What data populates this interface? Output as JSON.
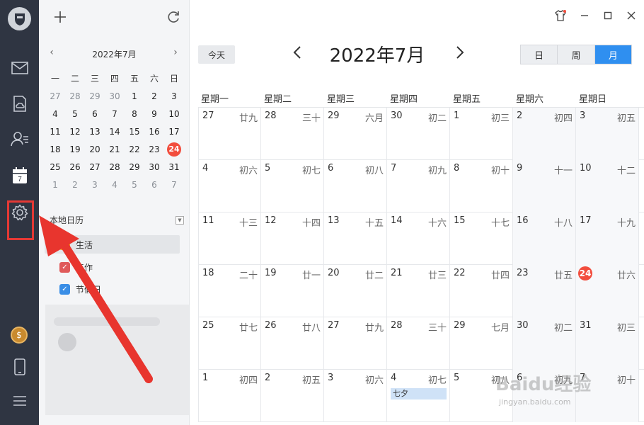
{
  "sidebar": {
    "mini_title": "2022年7月",
    "weekdays": [
      "一",
      "二",
      "三",
      "四",
      "五",
      "六",
      "日"
    ],
    "weeks": [
      [
        {
          "d": "27",
          "dim": true
        },
        {
          "d": "28",
          "dim": true
        },
        {
          "d": "29",
          "dim": true
        },
        {
          "d": "30",
          "dim": true
        },
        {
          "d": "1"
        },
        {
          "d": "2"
        },
        {
          "d": "3"
        }
      ],
      [
        {
          "d": "4"
        },
        {
          "d": "5"
        },
        {
          "d": "6"
        },
        {
          "d": "7"
        },
        {
          "d": "8"
        },
        {
          "d": "9"
        },
        {
          "d": "10"
        }
      ],
      [
        {
          "d": "11"
        },
        {
          "d": "12"
        },
        {
          "d": "13"
        },
        {
          "d": "14"
        },
        {
          "d": "15"
        },
        {
          "d": "16"
        },
        {
          "d": "17"
        }
      ],
      [
        {
          "d": "18"
        },
        {
          "d": "19"
        },
        {
          "d": "20"
        },
        {
          "d": "21"
        },
        {
          "d": "22"
        },
        {
          "d": "23"
        },
        {
          "d": "24",
          "today": true
        }
      ],
      [
        {
          "d": "25"
        },
        {
          "d": "26"
        },
        {
          "d": "27"
        },
        {
          "d": "28"
        },
        {
          "d": "29"
        },
        {
          "d": "30"
        },
        {
          "d": "31"
        }
      ],
      [
        {
          "d": "1",
          "dim": true
        },
        {
          "d": "2",
          "dim": true
        },
        {
          "d": "3",
          "dim": true
        },
        {
          "d": "4",
          "dim": true
        },
        {
          "d": "5",
          "dim": true
        },
        {
          "d": "6",
          "dim": true
        },
        {
          "d": "7",
          "dim": true
        }
      ]
    ],
    "section_label": "本地日历",
    "calendars": [
      {
        "label": "生活",
        "color": "#f5a623",
        "selected": true
      },
      {
        "label": "工作",
        "color": "#e05a5a",
        "selected": false
      },
      {
        "label": "节假日",
        "color": "#3a8ee6",
        "selected": false
      }
    ]
  },
  "rail": {
    "calendar_icon_day": "7"
  },
  "main": {
    "today_label": "今天",
    "month_title": "2022年7月",
    "views": [
      {
        "label": "日",
        "active": false
      },
      {
        "label": "周",
        "active": false
      },
      {
        "label": "月",
        "active": true
      }
    ],
    "weekdays": [
      "星期一",
      "星期二",
      "星期三",
      "星期四",
      "星期五",
      "星期六",
      "星期日"
    ],
    "weeks": [
      [
        {
          "d": "27",
          "l": "廿九",
          "dim": true
        },
        {
          "d": "28",
          "l": "三十",
          "dim": true
        },
        {
          "d": "29",
          "l": "六月",
          "dim": true
        },
        {
          "d": "30",
          "l": "初二",
          "dim": true
        },
        {
          "d": "1",
          "l": "初三"
        },
        {
          "d": "2",
          "l": "初四"
        },
        {
          "d": "3",
          "l": "初五"
        }
      ],
      [
        {
          "d": "4",
          "l": "初六"
        },
        {
          "d": "5",
          "l": "初七"
        },
        {
          "d": "6",
          "l": "初八"
        },
        {
          "d": "7",
          "l": "初九"
        },
        {
          "d": "8",
          "l": "初十"
        },
        {
          "d": "9",
          "l": "十一"
        },
        {
          "d": "10",
          "l": "十二"
        }
      ],
      [
        {
          "d": "11",
          "l": "十三"
        },
        {
          "d": "12",
          "l": "十四"
        },
        {
          "d": "13",
          "l": "十五"
        },
        {
          "d": "14",
          "l": "十六"
        },
        {
          "d": "15",
          "l": "十七"
        },
        {
          "d": "16",
          "l": "十八"
        },
        {
          "d": "17",
          "l": "十九"
        }
      ],
      [
        {
          "d": "18",
          "l": "二十"
        },
        {
          "d": "19",
          "l": "廿一"
        },
        {
          "d": "20",
          "l": "廿二"
        },
        {
          "d": "21",
          "l": "廿三"
        },
        {
          "d": "22",
          "l": "廿四"
        },
        {
          "d": "23",
          "l": "廿五"
        },
        {
          "d": "24",
          "l": "廿六",
          "today": true
        }
      ],
      [
        {
          "d": "25",
          "l": "廿七"
        },
        {
          "d": "26",
          "l": "廿八"
        },
        {
          "d": "27",
          "l": "廿九"
        },
        {
          "d": "28",
          "l": "三十"
        },
        {
          "d": "29",
          "l": "七月"
        },
        {
          "d": "30",
          "l": "初二"
        },
        {
          "d": "31",
          "l": "初三"
        }
      ],
      [
        {
          "d": "1",
          "l": "初四",
          "dim": true
        },
        {
          "d": "2",
          "l": "初五",
          "dim": true
        },
        {
          "d": "3",
          "l": "初六",
          "dim": true
        },
        {
          "d": "4",
          "l": "初七",
          "dim": true,
          "event": "七夕"
        },
        {
          "d": "5",
          "l": "初八",
          "dim": true
        },
        {
          "d": "6",
          "l": "初九",
          "dim": true
        },
        {
          "d": "7",
          "l": "初十",
          "dim": true
        }
      ]
    ]
  },
  "watermark": {
    "text": "Baidu经验",
    "url": "jingyan.baidu.com"
  },
  "colors": {
    "accent": "#2f8ff0",
    "today": "#f24d3d",
    "highlight_box": "#e53935",
    "rail_bg": "#2f3542"
  }
}
